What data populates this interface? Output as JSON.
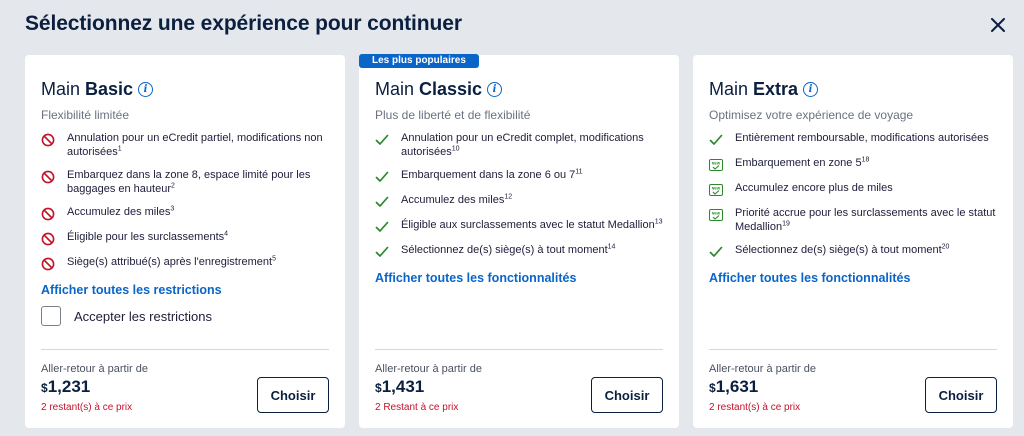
{
  "header": {
    "title": "Sélectionnez une expérience pour continuer",
    "close_icon": "close-icon"
  },
  "colors": {
    "accent": "#0a65c9",
    "danger": "#c0142b",
    "success": "#2a8a2a",
    "navy": "#0b1f3f"
  },
  "basic": {
    "prefix": "Main",
    "name": "Basic",
    "subtitle": "Flexibilité limitée",
    "features": [
      {
        "text": "Annulation pour un eCredit partiel, modifications non autorisées",
        "sup": "1",
        "icon": "prohibited-icon"
      },
      {
        "text": "Embarquez dans la zone 8, espace limité pour les baggages en hauteur",
        "sup": "2",
        "icon": "prohibited-icon"
      },
      {
        "text": "Accumulez des miles",
        "sup": "3",
        "icon": "prohibited-icon"
      },
      {
        "text": "Éligible pour les surclassements",
        "sup": "4",
        "icon": "prohibited-icon"
      },
      {
        "text": "Siège(s) attribué(s) après l'enregistrement",
        "sup": "5",
        "icon": "prohibited-icon"
      }
    ],
    "link": "Afficher toutes les restrictions",
    "checkbox_label": "Accepter les restrictions",
    "price_label": "Aller-retour à partir de",
    "currency": "$",
    "price": "1,231",
    "remaining": "2 restant(s) à ce prix",
    "button": "Choisir"
  },
  "classic": {
    "badge": "Les plus populaires",
    "prefix": "Main",
    "name": "Classic",
    "subtitle": "Plus de liberté et de flexibilité",
    "features": [
      {
        "text": "Annulation pour un eCredit complet, modifications autorisées",
        "sup": "10",
        "icon": "check-icon"
      },
      {
        "text": "Embarquement dans la zone 6 ou 7",
        "sup": "11",
        "icon": "check-icon"
      },
      {
        "text": "Accumulez des miles",
        "sup": "12",
        "icon": "check-icon"
      },
      {
        "text": "Éligible aux surclassements avec le statut Medallion",
        "sup": "13",
        "icon": "check-icon"
      },
      {
        "text": "Sélectionnez de(s) siège(s) à tout moment",
        "sup": "14",
        "icon": "check-icon"
      }
    ],
    "link": "Afficher toutes les fonctionnalités",
    "price_label": "Aller-retour à partir de",
    "currency": "$",
    "price": "1,431",
    "remaining": "2 Restant à ce prix",
    "button": "Choisir"
  },
  "extra": {
    "prefix": "Main",
    "name": "Extra",
    "subtitle": "Optimisez votre expérience de voyage",
    "features": [
      {
        "text": "Entièrement remboursable, modifications autorisées",
        "sup": "",
        "icon": "check-icon"
      },
      {
        "text": "Embarquement en zone 5",
        "sup": "18",
        "icon": "new-check-icon",
        "icon_text": "NEW"
      },
      {
        "text": "Accumulez encore plus de miles",
        "sup": "",
        "icon": "new-check-icon",
        "icon_text": "NEW"
      },
      {
        "text": "Priorité accrue pour les surclassements avec le statut Medallion",
        "sup": "19",
        "icon": "new-check-icon",
        "icon_text": "NEW"
      },
      {
        "text": "Sélectionnez de(s) siège(s) à tout moment",
        "sup": "20",
        "icon": "check-icon"
      }
    ],
    "link": "Afficher toutes les fonctionnalités",
    "price_label": "Aller-retour à partir de",
    "currency": "$",
    "price": "1,631",
    "remaining": "2 restant(s) à ce prix",
    "button": "Choisir"
  }
}
